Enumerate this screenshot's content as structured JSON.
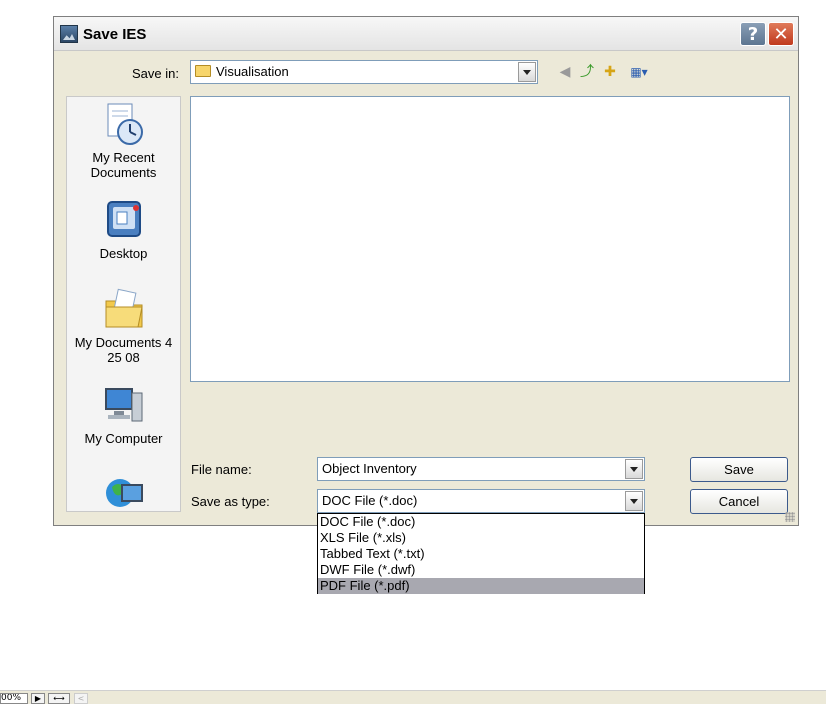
{
  "dialog": {
    "title": "Save IES",
    "help_glyph": "?",
    "close_glyph": "✕"
  },
  "save_in": {
    "label": "Save in:",
    "value": "Visualisation",
    "icon": "folder-icon",
    "toolbar": [
      {
        "name": "back-icon",
        "glyph": "◀"
      },
      {
        "name": "up-folder-icon",
        "glyph": "⤴"
      },
      {
        "name": "new-folder-icon",
        "glyph": "✚"
      },
      {
        "name": "views-menu-icon",
        "glyph": "▦▾"
      }
    ]
  },
  "places": [
    {
      "label": "My Recent Documents",
      "icon": "recent-documents-icon"
    },
    {
      "label": "Desktop",
      "icon": "desktop-icon"
    },
    {
      "label": "My Documents 4 25 08",
      "icon": "my-documents-icon"
    },
    {
      "label": "My Computer",
      "icon": "my-computer-icon"
    },
    {
      "label": "",
      "icon": "network-places-icon"
    }
  ],
  "file_name": {
    "label": "File name:",
    "value": "Object Inventory"
  },
  "save_as_type": {
    "label": "Save as type:",
    "value": "DOC File (*.doc)",
    "options": [
      "DOC File (*.doc)",
      "XLS File (*.xls)",
      "Tabbed Text (*.txt)",
      "DWF File (*.dwf)",
      "PDF File (*.pdf)"
    ],
    "highlighted": "PDF File (*.pdf)"
  },
  "buttons": {
    "save": "Save",
    "cancel": "Cancel"
  },
  "bottom_bar": {
    "zoom": "00%",
    "next_glyph": "▶",
    "fit_glyph": "⟷",
    "prev_glyph": "<"
  },
  "colors": {
    "dialog_bg": "#ece9d8",
    "highlight": "#a8a8b0",
    "close_red": "#c0391d"
  }
}
